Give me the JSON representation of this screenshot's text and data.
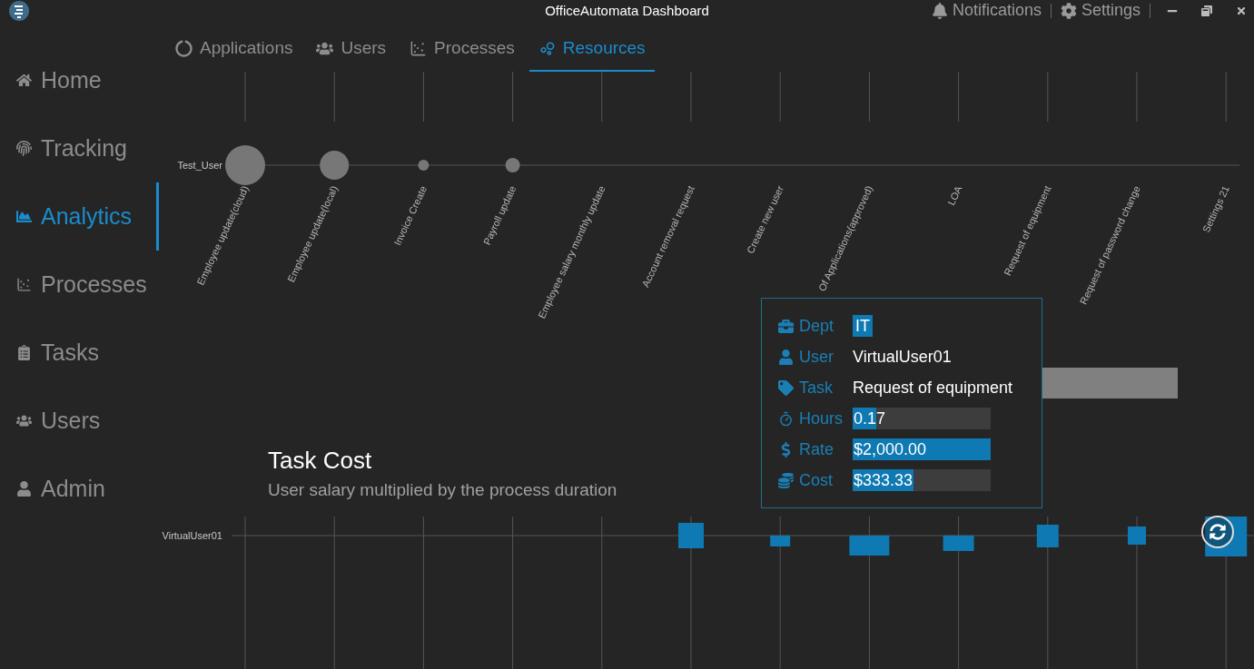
{
  "title_bar": {
    "title": "OfficeAutomata Dashboard",
    "actions": [
      {
        "label": "Notifications",
        "kind": "bell"
      },
      {
        "label": "Settings",
        "kind": "gear"
      }
    ]
  },
  "sidebar": {
    "items": [
      {
        "label": "Home",
        "selected": false
      },
      {
        "label": "Tracking",
        "selected": false
      },
      {
        "label": "Analytics",
        "selected": true
      },
      {
        "label": "Processes",
        "selected": false
      },
      {
        "label": "Tasks",
        "selected": false
      },
      {
        "label": "Users",
        "selected": false
      },
      {
        "label": "Admin",
        "selected": false
      }
    ]
  },
  "tabs": [
    {
      "label": "Applications",
      "selected": false
    },
    {
      "label": "Users",
      "selected": false
    },
    {
      "label": "Processes",
      "selected": false
    },
    {
      "label": "Resources",
      "selected": true
    }
  ],
  "resource_chart": {
    "row_label": "Test_User",
    "categories": [
      "Employee update(cloud)",
      "Employee update(local)",
      "Invoice Create",
      "Payroll update",
      "Employee salary monthly update",
      "Account removal request",
      "Create new user",
      "Of Applications(approved)",
      "LOA",
      "Request of equipment",
      "Request of password change",
      "Settings 21"
    ]
  },
  "task_cost": {
    "title": "Task Cost",
    "subtitle": "User salary multiplied by the process duration",
    "row_label": "VirtualUser01"
  },
  "tooltip": {
    "rows": [
      {
        "label": "Dept",
        "value": "IT",
        "kind": "highlight"
      },
      {
        "label": "User",
        "value": "VirtualUser01",
        "kind": "text"
      },
      {
        "label": "Task",
        "value": "Request of equipment",
        "kind": "text"
      },
      {
        "label": "Hours",
        "value": "0.17",
        "kind": "bar",
        "level": 0.17
      },
      {
        "label": "Rate",
        "value": "$2,000.00",
        "kind": "bar",
        "level": 1
      },
      {
        "label": "Cost",
        "value": "$333.33",
        "kind": "bar",
        "level": 0.44
      }
    ]
  }
}
